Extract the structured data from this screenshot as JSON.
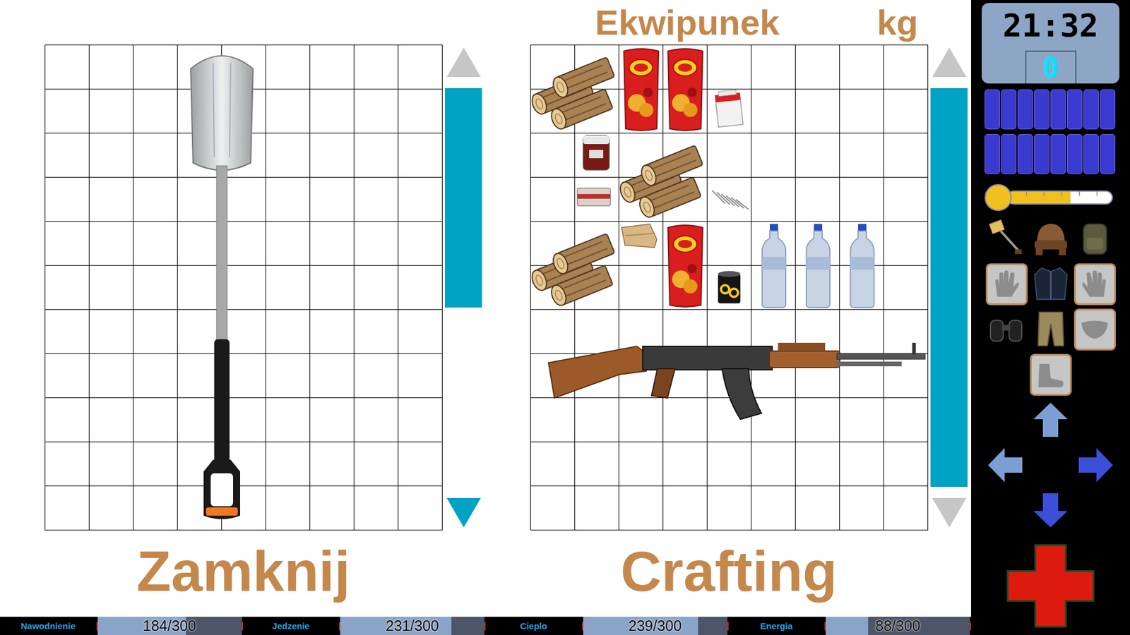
{
  "container": {
    "items": [
      {
        "kind": "shovel",
        "col": 3,
        "row": 0,
        "cols": 2,
        "rows": 11
      }
    ],
    "scrollbar": {
      "level": 0.55,
      "up_enabled": false,
      "down_enabled": true
    }
  },
  "inventory": {
    "title": "Ekwipunek",
    "weight_unit": "kg",
    "items": [
      {
        "kind": "wood",
        "col": 0,
        "row": 0,
        "cols": 2,
        "rows": 2
      },
      {
        "kind": "chips",
        "col": 2,
        "row": 0,
        "cols": 1,
        "rows": 2
      },
      {
        "kind": "chips",
        "col": 3,
        "row": 0,
        "cols": 1,
        "rows": 2
      },
      {
        "kind": "cigarettes",
        "col": 4,
        "row": 1,
        "cols": 1,
        "rows": 1
      },
      {
        "kind": "bloodbag",
        "col": 1,
        "row": 2,
        "cols": 1,
        "rows": 1
      },
      {
        "kind": "wood",
        "col": 2,
        "row": 2,
        "cols": 2,
        "rows": 2
      },
      {
        "kind": "ration",
        "col": 1,
        "row": 3,
        "cols": 1,
        "rows": 1
      },
      {
        "kind": "nails",
        "col": 4,
        "row": 3,
        "cols": 1,
        "rows": 1
      },
      {
        "kind": "wood",
        "col": 0,
        "row": 4,
        "cols": 2,
        "rows": 2
      },
      {
        "kind": "cloth",
        "col": 2,
        "row": 4,
        "cols": 1,
        "rows": 1
      },
      {
        "kind": "chips",
        "col": 3,
        "row": 4,
        "cols": 1,
        "rows": 2
      },
      {
        "kind": "can",
        "col": 4,
        "row": 5,
        "cols": 1,
        "rows": 1
      },
      {
        "kind": "bottle",
        "col": 5,
        "row": 4,
        "cols": 1,
        "rows": 2
      },
      {
        "kind": "bottle",
        "col": 6,
        "row": 4,
        "cols": 1,
        "rows": 2
      },
      {
        "kind": "bottle",
        "col": 7,
        "row": 4,
        "cols": 1,
        "rows": 2
      },
      {
        "kind": "rifle",
        "col": 0,
        "row": 6,
        "cols": 9,
        "rows": 3
      }
    ],
    "scrollbar": {
      "level": 1,
      "up_enabled": false,
      "down_enabled": false
    }
  },
  "buttons": [
    {
      "label": "Zamknij"
    },
    {
      "label": "Crafting"
    }
  ],
  "clock": {
    "time": "21:32",
    "counter": "0"
  },
  "battery": [
    {
      "on": true
    },
    {
      "on": true
    },
    {
      "on": true
    },
    {
      "on": true
    },
    {
      "on": true
    },
    {
      "on": true
    },
    {
      "on": true
    },
    {
      "on": true
    },
    {
      "on": true
    },
    {
      "on": true
    },
    {
      "on": true
    },
    {
      "on": true
    },
    {
      "on": true
    },
    {
      "on": true
    },
    {
      "on": true
    },
    {
      "on": true
    }
  ],
  "temperature": {
    "level": 0.6
  },
  "equipment": [
    {
      "kind": "tool",
      "filled": true
    },
    {
      "kind": "head",
      "filled": true
    },
    {
      "kind": "back",
      "filled": true
    },
    {
      "kind": "left-hand",
      "filled": false
    },
    {
      "kind": "torso",
      "filled": true
    },
    {
      "kind": "right-hand",
      "filled": false
    },
    {
      "kind": "optics",
      "filled": true
    },
    {
      "kind": "legs",
      "filled": true
    },
    {
      "kind": "face",
      "filled": false
    },
    {
      "kind": "feet",
      "filled": false
    }
  ],
  "arrows": [
    {
      "kind": "up",
      "active": false
    },
    {
      "kind": "left",
      "active": false
    },
    {
      "kind": "right",
      "active": true
    },
    {
      "kind": "down",
      "active": true
    }
  ],
  "status_bar": [
    {
      "label": "Nawodnienie",
      "reading": "184/300",
      "level": 0.613
    },
    {
      "label": "Jedzenie",
      "reading": "231/300",
      "level": 0.77
    },
    {
      "label": "Cieplo",
      "reading": "239/300",
      "level": 0.797
    },
    {
      "label": "Energia",
      "reading": "88/300",
      "level": 0.293
    }
  ]
}
